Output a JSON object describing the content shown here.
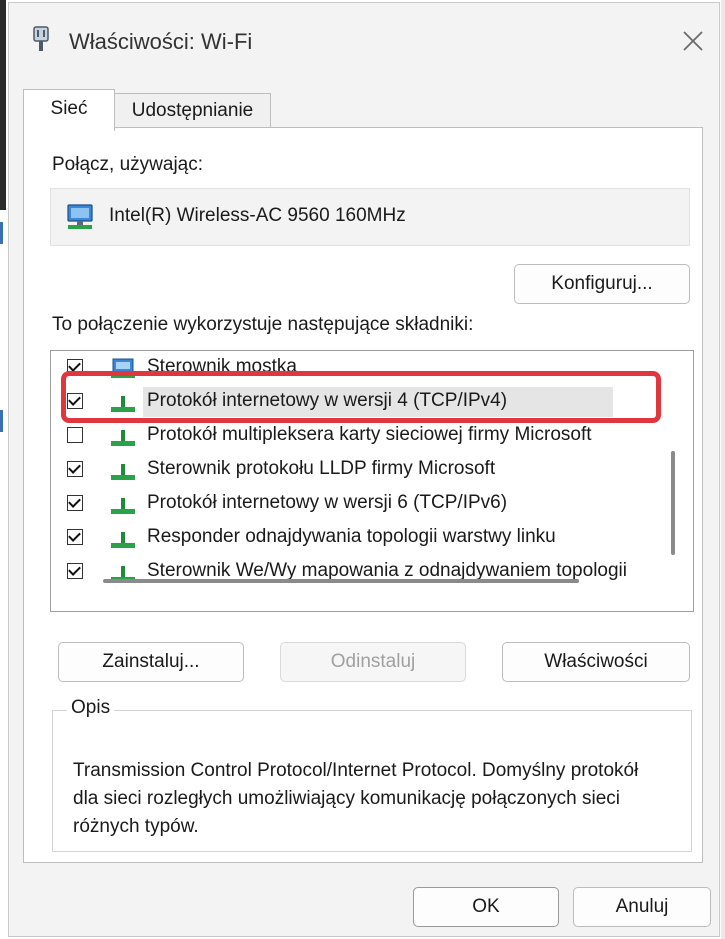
{
  "window": {
    "title": "Właściwości: Wi-Fi"
  },
  "tabs": [
    {
      "label": "Sieć",
      "active": true
    },
    {
      "label": "Udostępnianie",
      "active": false
    }
  ],
  "connect_using": {
    "label": "Połącz, używając:",
    "adapter_name": "Intel(R) Wireless-AC 9560 160MHz",
    "adapter_icon": "network-adapter-icon"
  },
  "buttons": {
    "configure": "Konfiguruj...",
    "install": "Zainstaluj...",
    "uninstall": "Odinstaluj",
    "properties": "Właściwości",
    "ok": "OK",
    "cancel": "Anuluj"
  },
  "components": {
    "label": "To połączenie wykorzystuje następujące składniki:",
    "items": [
      {
        "label": "Sterownik mostka",
        "checked": true,
        "icon": "bridge-driver-icon"
      },
      {
        "label": "Protokół internetowy w wersji 4 (TCP/IPv4)",
        "checked": true,
        "icon": "protocol-icon",
        "selected": true
      },
      {
        "label": "Protokół multipleksera karty sieciowej firmy Microsoft",
        "checked": false,
        "icon": "protocol-icon"
      },
      {
        "label": "Sterownik protokołu LLDP firmy Microsoft",
        "checked": true,
        "icon": "protocol-icon"
      },
      {
        "label": "Protokół internetowy w wersji 6 (TCP/IPv6)",
        "checked": true,
        "icon": "protocol-icon"
      },
      {
        "label": "Responder odnajdywania topologii warstwy linku",
        "checked": true,
        "icon": "protocol-icon"
      },
      {
        "label": "Sterownik We/Wy mapowania z odnajdywaniem topologii",
        "checked": true,
        "icon": "protocol-icon"
      }
    ]
  },
  "description": {
    "legend": "Opis",
    "text": "Transmission Control Protocol/Internet Protocol. Domyślny protokół dla sieci rozległych umożliwiający komunikację połączonych sieci różnych typów."
  },
  "colors": {
    "highlight": "#e0373e",
    "protocol_icon": "#1f8a3a",
    "adapter_icon": "#2a6fb8"
  }
}
